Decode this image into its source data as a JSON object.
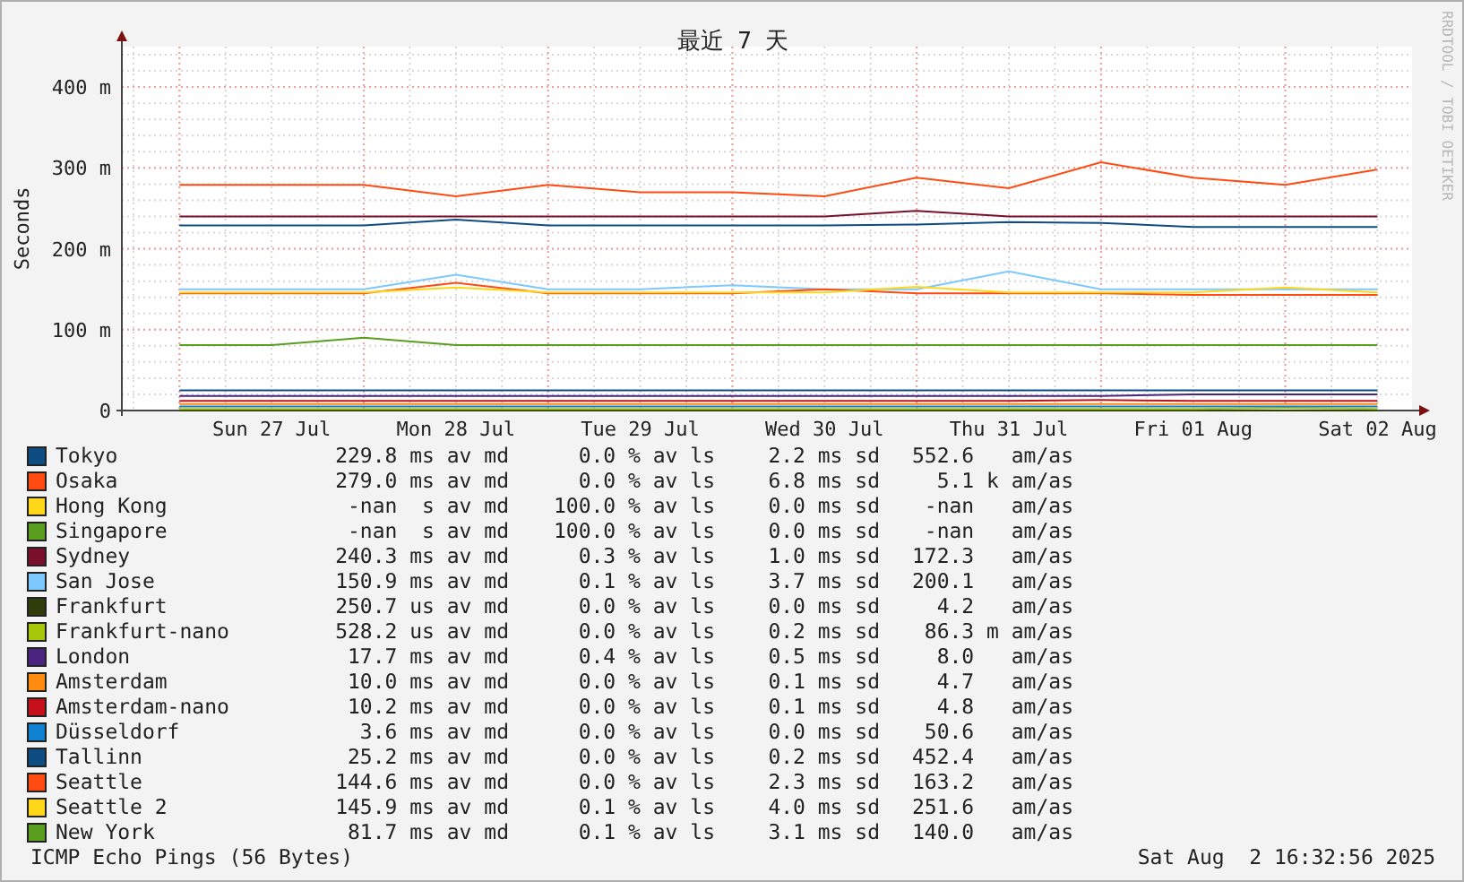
{
  "chart_data": {
    "type": "line",
    "title": "最近 7 天",
    "ylabel": "Seconds",
    "ylim": [
      0,
      450
    ],
    "grid": true,
    "categories": [
      null,
      "Sun 27 Jul",
      null,
      "Mon 28 Jul",
      null,
      "Tue 29 Jul",
      null,
      "Wed 30 Jul",
      null,
      "Thu 31 Jul",
      null,
      "Fri 01 Aug",
      null,
      "Sat 02 Aug"
    ],
    "yticks": [
      {
        "value": 0,
        "label": "0"
      },
      {
        "value": 100,
        "label": "100 m"
      },
      {
        "value": 200,
        "label": "200 m"
      },
      {
        "value": 300,
        "label": "300 m"
      },
      {
        "value": 400,
        "label": "400 m"
      }
    ],
    "series": [
      {
        "name": "Tokyo",
        "color": "#0f4c81",
        "values": [
          229,
          229,
          229,
          236,
          229,
          229,
          229,
          229,
          230,
          233,
          232,
          227,
          227,
          227
        ]
      },
      {
        "name": "Osaka",
        "color": "#ff4a12",
        "values": [
          279,
          279,
          279,
          265,
          279,
          270,
          270,
          265,
          288,
          275,
          307,
          288,
          279,
          298
        ]
      },
      {
        "name": "Hong Kong",
        "color": "#ffd71a",
        "values": [
          null,
          null,
          null,
          null,
          null,
          null,
          null,
          null,
          null,
          null,
          null,
          null,
          null,
          null
        ]
      },
      {
        "name": "Singapore",
        "color": "#5a9e1f",
        "values": [
          null,
          null,
          null,
          null,
          null,
          null,
          null,
          null,
          null,
          null,
          null,
          null,
          null,
          null
        ]
      },
      {
        "name": "Sydney",
        "color": "#7a0f2c",
        "values": [
          240,
          240,
          240,
          240,
          240,
          240,
          240,
          240,
          247,
          240,
          240,
          240,
          240,
          240
        ]
      },
      {
        "name": "San Jose",
        "color": "#7cc8ff",
        "values": [
          150,
          150,
          150,
          168,
          150,
          150,
          155,
          150,
          150,
          172,
          150,
          150,
          150,
          150
        ]
      },
      {
        "name": "Frankfurt",
        "color": "#2f3d0a",
        "values": [
          0,
          0,
          0,
          0,
          0,
          0,
          0,
          0,
          0,
          0,
          0,
          0,
          0,
          0
        ]
      },
      {
        "name": "Frankfurt-nano",
        "color": "#a6c70a",
        "values": [
          2,
          2,
          2,
          2,
          2,
          2,
          2,
          2,
          2,
          2,
          2,
          2,
          3,
          2
        ]
      },
      {
        "name": "London",
        "color": "#4b2480",
        "values": [
          18,
          18,
          18,
          18,
          18,
          18,
          18,
          18,
          18,
          18,
          18,
          20,
          20,
          20
        ]
      },
      {
        "name": "Amsterdam",
        "color": "#ff8c10",
        "values": [
          8,
          8,
          8,
          8,
          8,
          8,
          8,
          8,
          8,
          8,
          8,
          8,
          8,
          8
        ]
      },
      {
        "name": "Amsterdam-nano",
        "color": "#c4101a",
        "values": [
          12,
          12,
          12,
          12,
          12,
          12,
          12,
          12,
          12,
          12,
          13,
          12,
          12,
          12
        ]
      },
      {
        "name": "Düsseldorf",
        "color": "#1080d0",
        "values": [
          5,
          5,
          5,
          5,
          5,
          5,
          5,
          5,
          5,
          5,
          5,
          5,
          5,
          5
        ]
      },
      {
        "name": "Tallinn",
        "color": "#0f4c81",
        "values": [
          25,
          25,
          25,
          25,
          25,
          25,
          25,
          25,
          25,
          25,
          25,
          25,
          25,
          25
        ]
      },
      {
        "name": "Seattle",
        "color": "#ff4a12",
        "values": [
          145,
          145,
          145,
          158,
          145,
          145,
          145,
          150,
          145,
          145,
          145,
          143,
          143,
          143
        ]
      },
      {
        "name": "Seattle 2",
        "color": "#ffd71a",
        "values": [
          146,
          146,
          146,
          152,
          146,
          146,
          146,
          146,
          153,
          146,
          146,
          146,
          152,
          146
        ]
      },
      {
        "name": "New York",
        "color": "#5a9e1f",
        "values": [
          81,
          81,
          90,
          81,
          81,
          81,
          81,
          81,
          81,
          81,
          81,
          81,
          81,
          81
        ]
      }
    ]
  },
  "side_label": "RRDTOOL / TOBI OETIKER",
  "legend": [
    {
      "median": "229.8 ms av md",
      "loss": "0.0 % av ls",
      "sd": "2.2 ms sd",
      "ratio": "552.6   am/as"
    },
    {
      "median": "279.0 ms av md",
      "loss": "0.0 % av ls",
      "sd": "6.8 ms sd",
      "ratio": "5.1 k am/as"
    },
    {
      "median": "-nan  s av md",
      "loss": "100.0 % av ls",
      "sd": "0.0 ms sd",
      "ratio": "-nan   am/as"
    },
    {
      "median": "-nan  s av md",
      "loss": "100.0 % av ls",
      "sd": "0.0 ms sd",
      "ratio": "-nan   am/as"
    },
    {
      "median": "240.3 ms av md",
      "loss": "0.3 % av ls",
      "sd": "1.0 ms sd",
      "ratio": "172.3   am/as"
    },
    {
      "median": "150.9 ms av md",
      "loss": "0.1 % av ls",
      "sd": "3.7 ms sd",
      "ratio": "200.1   am/as"
    },
    {
      "median": "250.7 us av md",
      "loss": "0.0 % av ls",
      "sd": "0.0 ms sd",
      "ratio": "4.2   am/as"
    },
    {
      "median": "528.2 us av md",
      "loss": "0.0 % av ls",
      "sd": "0.2 ms sd",
      "ratio": "86.3 m am/as"
    },
    {
      "median": "17.7 ms av md",
      "loss": "0.4 % av ls",
      "sd": "0.5 ms sd",
      "ratio": "8.0   am/as"
    },
    {
      "median": "10.0 ms av md",
      "loss": "0.0 % av ls",
      "sd": "0.1 ms sd",
      "ratio": "4.7   am/as"
    },
    {
      "median": "10.2 ms av md",
      "loss": "0.0 % av ls",
      "sd": "0.1 ms sd",
      "ratio": "4.8   am/as"
    },
    {
      "median": "3.6 ms av md",
      "loss": "0.0 % av ls",
      "sd": "0.0 ms sd",
      "ratio": "50.6   am/as"
    },
    {
      "median": "25.2 ms av md",
      "loss": "0.0 % av ls",
      "sd": "0.2 ms sd",
      "ratio": "452.4   am/as"
    },
    {
      "median": "144.6 ms av md",
      "loss": "0.0 % av ls",
      "sd": "2.3 ms sd",
      "ratio": "163.2   am/as"
    },
    {
      "median": "145.9 ms av md",
      "loss": "0.1 % av ls",
      "sd": "4.0 ms sd",
      "ratio": "251.6   am/as"
    },
    {
      "median": "81.7 ms av md",
      "loss": "0.1 % av ls",
      "sd": "3.1 ms sd",
      "ratio": "140.0   am/as"
    }
  ],
  "footer": {
    "probe": "ICMP Echo Pings (56 Bytes)",
    "timestamp": "Sat Aug  2 16:32:56 2025"
  }
}
